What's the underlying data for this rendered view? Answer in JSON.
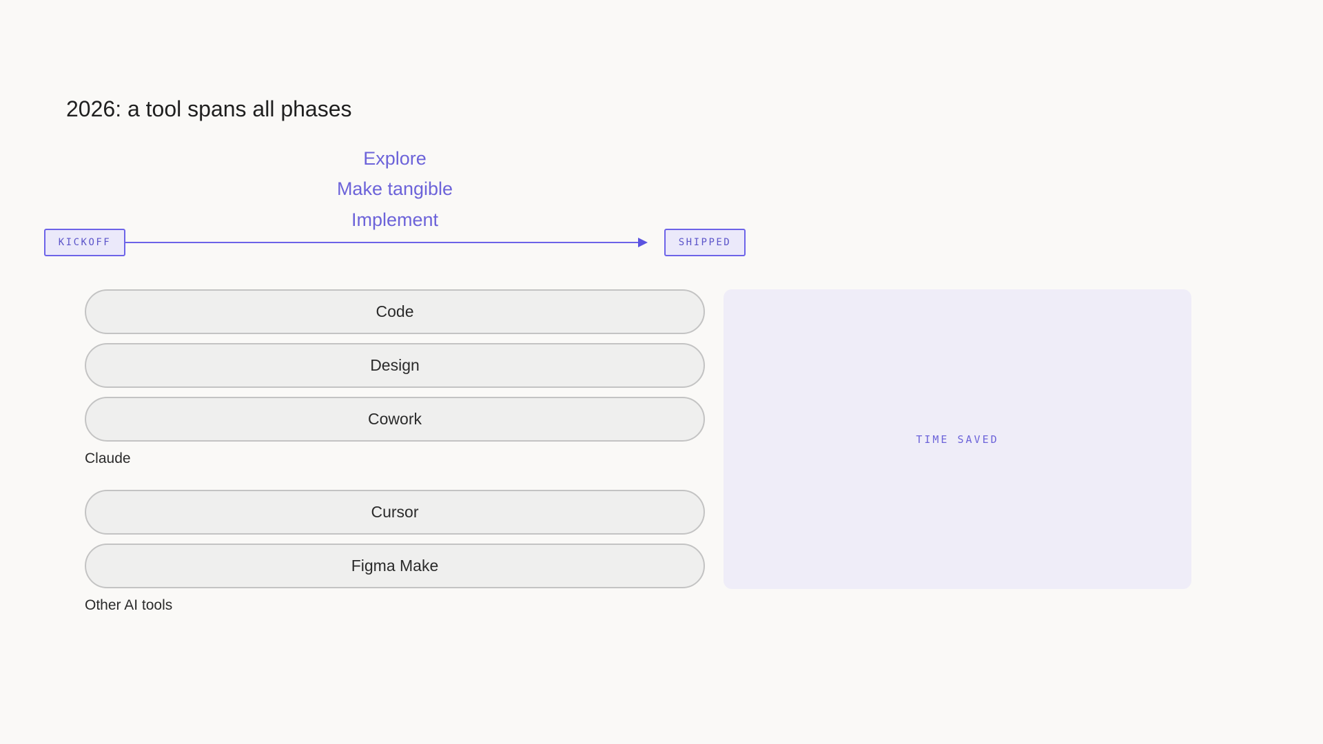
{
  "title": "2026: a tool spans all phases",
  "phases": [
    "Explore",
    "Make tangible",
    "Implement"
  ],
  "timeline": {
    "start_label": "KICKOFF",
    "end_label": "SHIPPED"
  },
  "groups": [
    {
      "label": "Claude",
      "items": [
        "Code",
        "Design",
        "Cowork"
      ]
    },
    {
      "label": "Other AI tools",
      "items": [
        "Cursor",
        "Figma Make"
      ]
    }
  ],
  "panel": {
    "label": "TIME SAVED"
  },
  "colors": {
    "accent": "#6c63e8",
    "panel_bg": "#efedf8",
    "pill_bg": "#efefee",
    "page_bg": "#faf9f7"
  }
}
